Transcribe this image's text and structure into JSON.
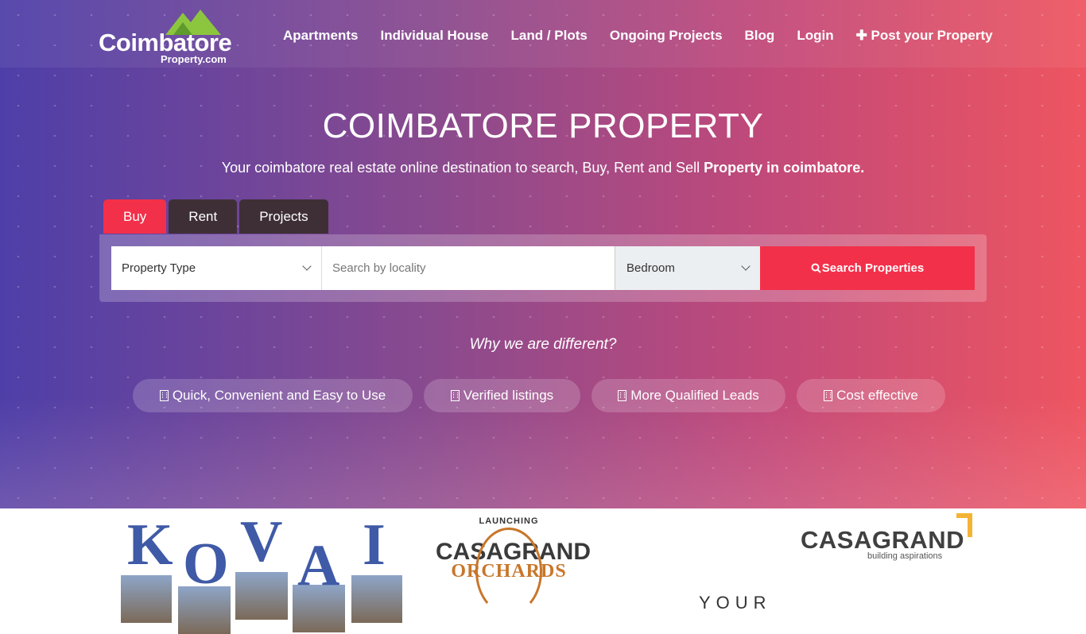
{
  "logo": {
    "name": "Coimbatore",
    "sub": "Property.com"
  },
  "nav": {
    "items": [
      "Apartments",
      "Individual House",
      "Land / Plots",
      "Ongoing Projects",
      "Blog",
      "Login",
      "✚ Post your Property"
    ]
  },
  "hero": {
    "title": "COIMBATORE PROPERTY",
    "subtitle_plain": "Your coimbatore real estate online destination to search, Buy, Rent and Sell ",
    "subtitle_bold": "Property in coimbatore."
  },
  "tabs": [
    "Buy",
    "Rent",
    "Projects"
  ],
  "search": {
    "property_type": "Property Type",
    "locality_placeholder": "Search by locality",
    "bedroom": "Bedroom",
    "button_label": "Search Properties"
  },
  "why": {
    "heading": "Why we are different?",
    "items": [
      "Quick, Convenient and Easy to Use",
      "Verified listings",
      "More Qualified Leads",
      "Cost effective"
    ]
  },
  "ads": {
    "kovai_letters": [
      "K",
      "O",
      "V",
      "A",
      "I"
    ],
    "orchards": {
      "launching": "LAUNCHING",
      "brand": "CASAGRAND",
      "project": "ORCHARDS"
    },
    "casagrand": {
      "name": "CASAGRAND",
      "tagline": "building aspirations"
    },
    "your_text": "YOUR"
  },
  "colors": {
    "accent": "#f3304a",
    "tab_dark": "#3e2f36",
    "logo_green": "#8cc63f"
  }
}
